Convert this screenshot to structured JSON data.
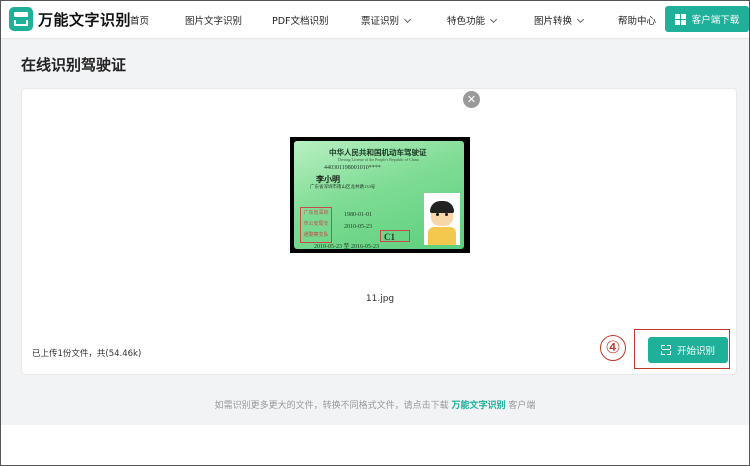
{
  "brand": {
    "name": "万能文字识别",
    "logo_icon": "scanner-logo-icon",
    "accent_color": "#1fb09a"
  },
  "nav": {
    "items": [
      {
        "label": "首页",
        "has_dropdown": false
      },
      {
        "label": "图片文字识别",
        "has_dropdown": false
      },
      {
        "label": "PDF文档识别",
        "has_dropdown": false
      },
      {
        "label": "票证识别",
        "has_dropdown": true
      },
      {
        "label": "特色功能",
        "has_dropdown": true
      },
      {
        "label": "图片转换",
        "has_dropdown": true
      },
      {
        "label": "帮助中心",
        "has_dropdown": false
      }
    ],
    "download_label": "客户端下载",
    "download_icon": "windows-icon"
  },
  "page": {
    "title": "在线识别驾驶证"
  },
  "upload": {
    "preview": {
      "title": "中华人民共和国机动车驾驶证",
      "subtitle": "Driving License of the People's Republic of China",
      "license_no": "440301198001010****",
      "name": "李小明",
      "address": "广东省深圳市南山区龙井路133号",
      "birth_date": "1980-01-01",
      "first_issue": "2010-05-23",
      "class": "C1",
      "valid_period": "2010-05-23  至  2016-05-23",
      "stamp_text": [
        "广东省深圳",
        "市公安局交",
        "通警察支队"
      ]
    },
    "file_name": "11.jpg",
    "summary": "已上传1份文件，共(54.46k)",
    "remove_icon": "close-icon",
    "step_marker": "④",
    "start_label": "开始识别",
    "start_icon": "scan-icon"
  },
  "footer": {
    "prefix": "如需识别更多更大的文件，转换不同格式文件，请点击下载",
    "link": "万能文字识别",
    "suffix": "客户端"
  }
}
